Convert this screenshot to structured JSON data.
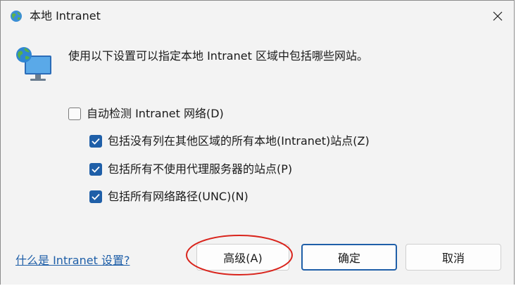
{
  "window": {
    "title": "本地 Intranet",
    "close_icon": "close-icon",
    "title_icon": "globe-icon"
  },
  "main": {
    "icon": "globe-monitor-icon",
    "description": "使用以下设置可以指定本地 Intranet 区域中包括哪些网站。"
  },
  "options": {
    "auto_detect": {
      "label": "自动检测 Intranet 网络(D)",
      "checked": false
    },
    "include_local": {
      "label": "包括没有列在其他区域的所有本地(Intranet)站点(Z)",
      "checked": true
    },
    "include_bypass_proxy": {
      "label": "包括所有不使用代理服务器的站点(P)",
      "checked": true
    },
    "include_unc": {
      "label": "包括所有网络路径(UNC)(N)",
      "checked": true
    }
  },
  "footer": {
    "help_link": "什么是 Intranet 设置?",
    "advanced_button": "高级(A)",
    "ok_button": "确定",
    "cancel_button": "取消"
  },
  "colors": {
    "accent": "#1f5fa8",
    "annotation_circle": "#d9241c"
  }
}
